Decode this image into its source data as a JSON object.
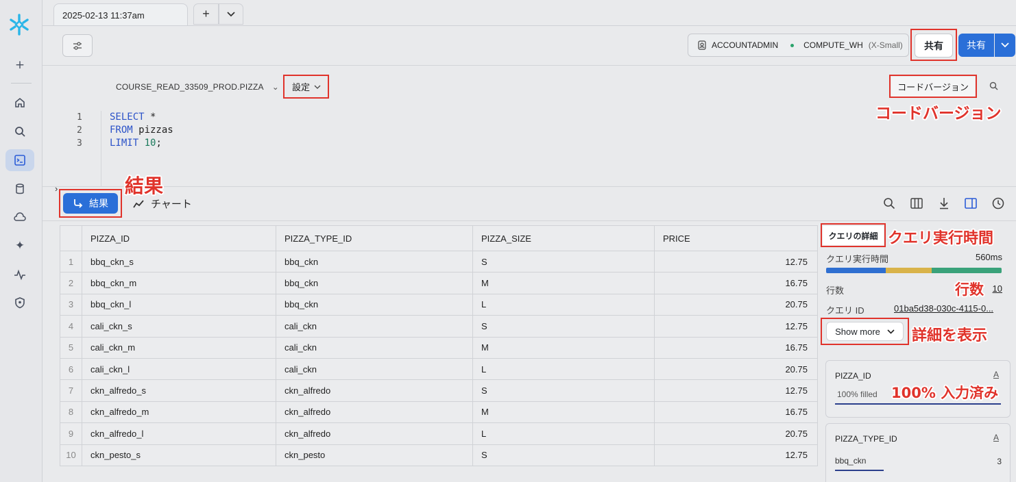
{
  "tab": {
    "title": "2025-02-13 11:37am",
    "add_label": "+",
    "menu_label": "⌄"
  },
  "context": {
    "role": "ACCOUNTADMIN",
    "warehouse": "COMPUTE_WH",
    "warehouse_size": "(X-Small)"
  },
  "share": {
    "button_label": "共有",
    "primary_label": "共有"
  },
  "editor": {
    "database": "COURSE_READ_33509_PROD.PIZZA",
    "settings_label": "設定",
    "code_version_label": "コードバージョン",
    "lines": [
      "1",
      "2",
      "3"
    ],
    "code": {
      "l1_kw": "SELECT",
      "l1_rest": " *",
      "l2_kw": "FROM",
      "l2_rest": " pizzas",
      "l3_kw": "LIMIT",
      "l3_num": " 10",
      "l3_rest": ";"
    }
  },
  "results_bar": {
    "results_label": "結果",
    "chart_label": "チャート"
  },
  "table": {
    "columns": [
      "PIZZA_ID",
      "PIZZA_TYPE_ID",
      "PIZZA_SIZE",
      "PRICE"
    ],
    "rows": [
      [
        "1",
        "bbq_ckn_s",
        "bbq_ckn",
        "S",
        "12.75"
      ],
      [
        "2",
        "bbq_ckn_m",
        "bbq_ckn",
        "M",
        "16.75"
      ],
      [
        "3",
        "bbq_ckn_l",
        "bbq_ckn",
        "L",
        "20.75"
      ],
      [
        "4",
        "cali_ckn_s",
        "cali_ckn",
        "S",
        "12.75"
      ],
      [
        "5",
        "cali_ckn_m",
        "cali_ckn",
        "M",
        "16.75"
      ],
      [
        "6",
        "cali_ckn_l",
        "cali_ckn",
        "L",
        "20.75"
      ],
      [
        "7",
        "ckn_alfredo_s",
        "ckn_alfredo",
        "S",
        "12.75"
      ],
      [
        "8",
        "ckn_alfredo_m",
        "ckn_alfredo",
        "M",
        "16.75"
      ],
      [
        "9",
        "ckn_alfredo_l",
        "ckn_alfredo",
        "L",
        "20.75"
      ],
      [
        "10",
        "ckn_pesto_s",
        "ckn_pesto",
        "S",
        "12.75"
      ]
    ]
  },
  "details": {
    "title": "クエリの詳細",
    "exec_time_label": "クエリ実行時間",
    "exec_time_value": "560ms",
    "rows_label": "行数",
    "rows_value": "10",
    "query_id_label": "クエリ ID",
    "query_id_value": "01ba5d38-030c-4115-0...",
    "show_more_label": "Show more",
    "timing_segments": [
      {
        "color": "#2f6fd1",
        "fraction": 0.34
      },
      {
        "color": "#d9b34a",
        "fraction": 0.26
      },
      {
        "color": "#3aa27a",
        "fraction": 0.4
      }
    ]
  },
  "column_cards": [
    {
      "name": "PIZZA_ID",
      "type_icon": "A",
      "stat": "100% filled"
    },
    {
      "name": "PIZZA_TYPE_ID",
      "type_icon": "A",
      "stat": "bbq_ckn",
      "count": "3"
    }
  ],
  "annotations": {
    "code_version": "コードバージョン",
    "results": "結果",
    "exec_time": "クエリ実行時間",
    "rows": "行数",
    "show_details": "詳細を表示",
    "filled": "100% 入力済み"
  },
  "colors": {
    "accent": "#2a6fd8",
    "annotation": "#e0332b"
  }
}
